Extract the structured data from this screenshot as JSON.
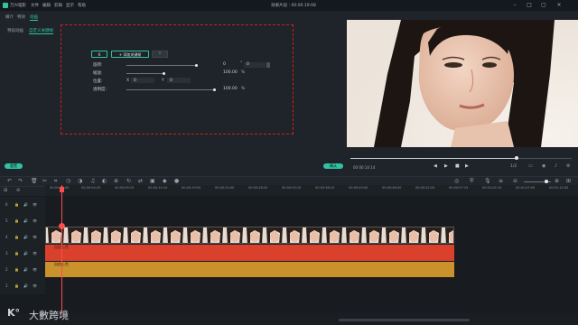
{
  "app": {
    "menus": [
      "万兴喵影",
      "文件",
      "编辑",
      "剪辑",
      "显示",
      "帮助"
    ],
    "window_title": "效果片段 : 00:00:19:08"
  },
  "subtabs": [
    "媒介",
    "特效",
    "动画"
  ],
  "left_nav": [
    "预设动画",
    "自定义关键帧"
  ],
  "keyframe_panel": {
    "small_button": "K",
    "add_button": "添加关键帧",
    "extra_button": "×",
    "rotate_label": "旋转:",
    "rotate_value": "0",
    "rotate_unit": "°",
    "rotate_value2": "0",
    "scale_label": "缩放:",
    "scale_value": "100.00",
    "scale_unit": "%",
    "position_label": "位置:",
    "pos_x_label": "X",
    "pos_x_value": "0",
    "pos_y_label": "Y",
    "pos_y_value": "0",
    "opacity_label": "透明度:",
    "opacity_value": "100.00",
    "opacity_unit": "%"
  },
  "buttons": {
    "reset": "重置",
    "ok": "确认"
  },
  "player": {
    "timecode": "00:00:14:14",
    "ratio": "1/2",
    "scrub_progress": 0.75
  },
  "ruler_labels": [
    "00:00:00:00",
    "00:00:04:20",
    "00:00:09:15",
    "00:00:14:10",
    "00:00:19:05",
    "00:00:24:00",
    "00:00:28:20",
    "00:00:33:15",
    "00:00:38:10",
    "00:00:43:05",
    "00:00:48:00",
    "00:00:52:20",
    "00:00:57:15",
    "00:01:02:10",
    "00:01:07:05",
    "00:01:12:00",
    "00:01:16:20",
    "00:01:21:15"
  ],
  "tracks": [
    "6",
    "5",
    "4",
    "3",
    "2",
    "1"
  ],
  "clips": {
    "red_label": "自由上色",
    "gold_label": "自由上色"
  },
  "watermark": "大數跨境",
  "colors": {
    "accent": "#2fc3a3",
    "dashed_border": "#d21c1c",
    "red_clip": "#d9412d",
    "gold_clip": "#c9922d",
    "playhead": "#ff4b4b"
  }
}
